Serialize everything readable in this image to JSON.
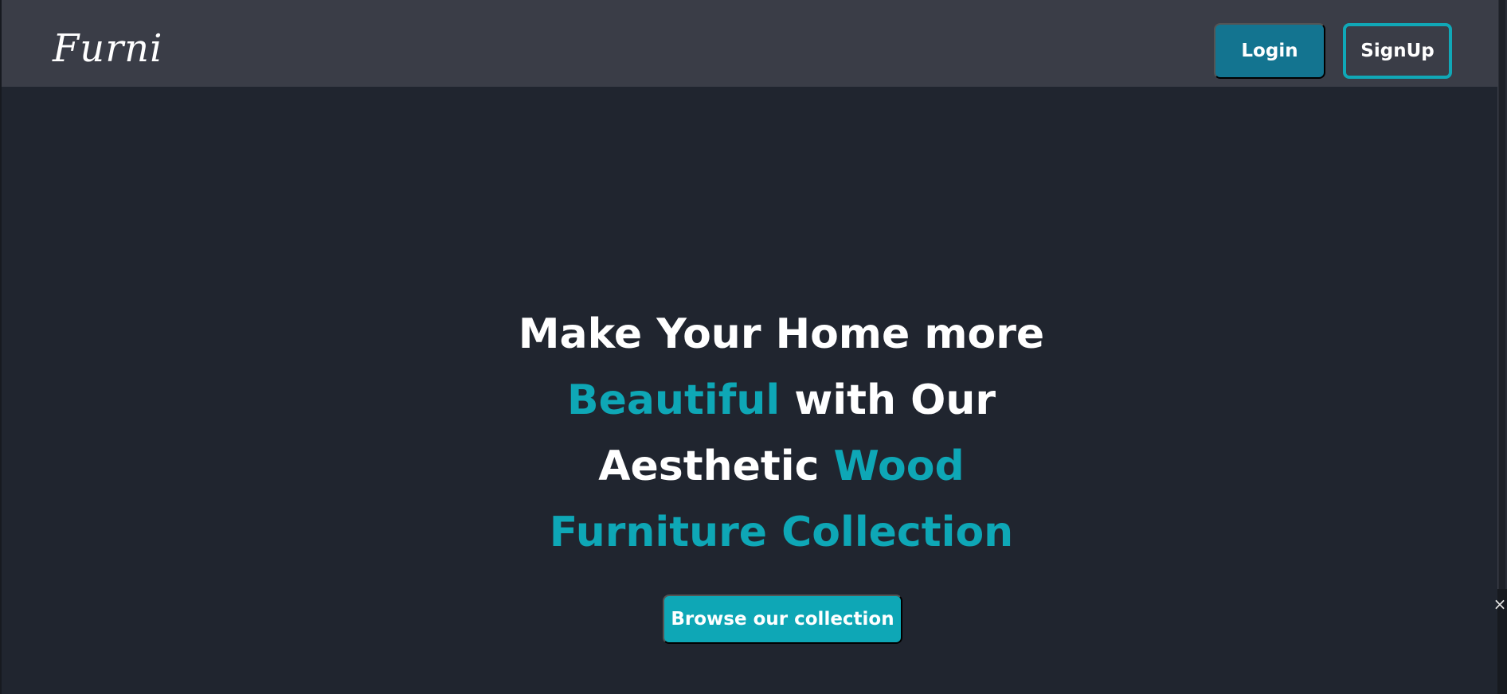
{
  "header": {
    "logo": "Furni",
    "login_label": "Login",
    "signup_label": "SignUp"
  },
  "hero": {
    "line1": "Make Your Home more",
    "line2_accent": "Beautiful",
    "line2_rest": " with Our",
    "line3_start": "Aesthetic ",
    "line3_accent": "Wood",
    "line4_accent": "Furniture Collection",
    "cta_label": "Browse our collection"
  },
  "colors": {
    "background": "#20252f",
    "header": "#3a3d47",
    "accent": "#0ea7b6",
    "login_button": "#137490",
    "text": "#ffffff"
  },
  "icons": {
    "close": "close-icon"
  }
}
